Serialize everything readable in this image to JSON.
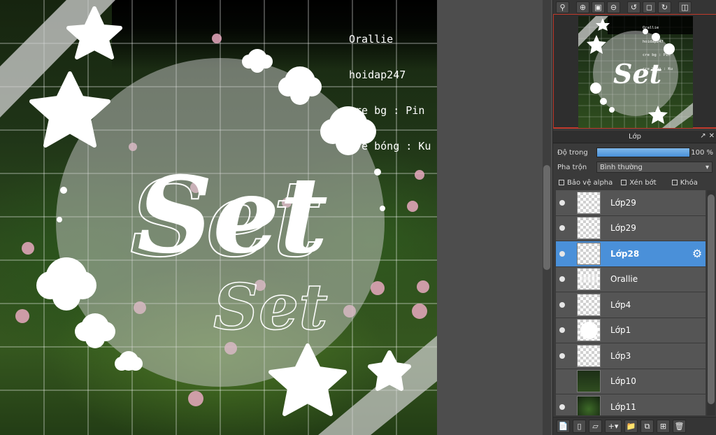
{
  "canvas": {
    "credit_lines": [
      "Orallie",
      "hoidap247",
      "cre bg : Pin",
      "cre bóng : Ku"
    ],
    "art_text_main": "Set",
    "art_text_outline": "Set"
  },
  "navigator": {
    "credit_lines": [
      "Orallie",
      "hoidap247",
      "cre bg : Pin",
      "cre bóng : Ku"
    ],
    "art_text": "Set",
    "toolbar_icons": [
      "zoom-fit-icon",
      "zoom-in-icon",
      "fit-window-icon",
      "zoom-out-icon",
      "rotate-left-icon",
      "rotate-reset-icon",
      "rotate-right-icon",
      "flip-icon"
    ]
  },
  "layers_panel": {
    "title": "Lớp",
    "opacity_label": "Độ trong",
    "opacity_value": "100 %",
    "opacity_fraction": 1.0,
    "blend_label": "Pha trộn",
    "blend_value": "Bình thường",
    "checks": {
      "protect_alpha": "Bảo vệ alpha",
      "clipping": "Xén bớt",
      "lock": "Khóa"
    },
    "layers": [
      {
        "name": "Lớp29",
        "visible": true,
        "selected": false,
        "thumb": "checker"
      },
      {
        "name": "Lớp29",
        "visible": true,
        "selected": false,
        "thumb": "checker"
      },
      {
        "name": "Lớp28",
        "visible": true,
        "selected": true,
        "thumb": "checker"
      },
      {
        "name": "Orallie",
        "visible": true,
        "selected": false,
        "thumb": "stripe"
      },
      {
        "name": "Lớp4",
        "visible": true,
        "selected": false,
        "thumb": "checker"
      },
      {
        "name": "Lớp1",
        "visible": true,
        "selected": false,
        "thumb": "circle"
      },
      {
        "name": "Lớp3",
        "visible": true,
        "selected": false,
        "thumb": "checker"
      },
      {
        "name": "Lớp10",
        "visible": false,
        "selected": false,
        "thumb": "photo"
      },
      {
        "name": "Lớp11",
        "visible": true,
        "selected": false,
        "thumb": "photo2"
      }
    ]
  },
  "colors": {
    "selected_layer": "#4a90d9",
    "navigator_frame": "#c0392b"
  }
}
